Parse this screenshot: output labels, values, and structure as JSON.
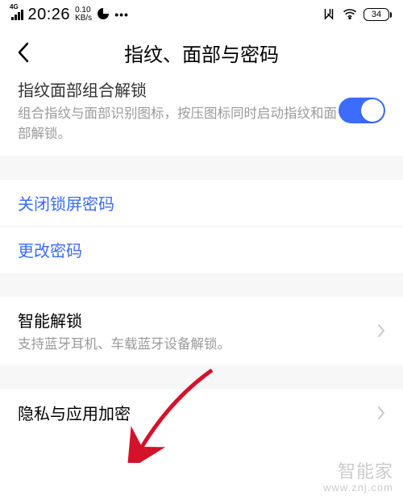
{
  "status": {
    "network_gen": "4G",
    "time": "20:26",
    "kbps_top": "0.10",
    "kbps_bottom": "KB/s",
    "dots": "•••",
    "battery_pct": "34"
  },
  "header": {
    "title": "指纹、面部与密码"
  },
  "rows": {
    "combo": {
      "label": "指纹面部组合解锁",
      "sub": "组合指纹与面部识别图标，按压图标同时启动指纹和面部解锁。",
      "toggle_on": true
    },
    "turn_off_pwd": {
      "label": "关闭锁屏密码"
    },
    "change_pwd": {
      "label": "更改密码"
    },
    "smart_unlock": {
      "label": "智能解锁",
      "sub": "支持蓝牙耳机、车载蓝牙设备解锁。"
    },
    "privacy_encrypt": {
      "label": "隐私与应用加密"
    }
  },
  "watermark": {
    "line1": "智能家",
    "line2": "www.znj.com"
  },
  "colors": {
    "accent": "#3b6cff",
    "arrow": "#d4122a",
    "gray_text": "#9a9a9a"
  }
}
